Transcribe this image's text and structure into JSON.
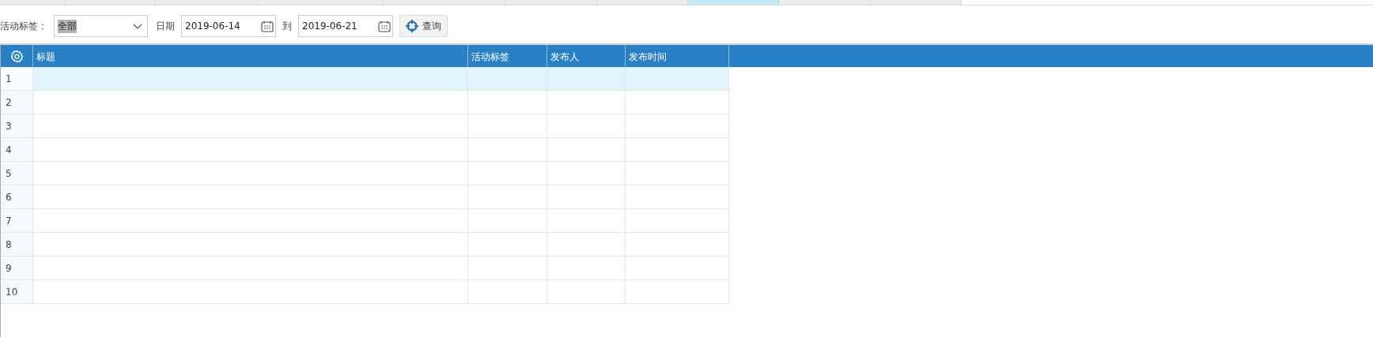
{
  "tabs": [
    {
      "selected": false
    },
    {
      "selected": false
    },
    {
      "selected": false
    },
    {
      "selected": false
    },
    {
      "selected": false
    },
    {
      "selected": false
    },
    {
      "selected": false
    },
    {
      "selected": true
    },
    {
      "selected": false
    },
    {
      "selected": false
    }
  ],
  "filters": {
    "tag_label": "活动标签：",
    "tag_value": "全部",
    "date_label": "日期",
    "date_from": "2019-06-14",
    "to_label": "到",
    "date_to": "2019-06-21",
    "query_button": "查询"
  },
  "table": {
    "columns": [
      "标题",
      "活动标签",
      "发布人",
      "发布时间"
    ],
    "rows": [
      {
        "number": "1",
        "selected": true
      },
      {
        "number": "2",
        "selected": false
      },
      {
        "number": "3",
        "selected": false
      },
      {
        "number": "4",
        "selected": false
      },
      {
        "number": "5",
        "selected": false
      },
      {
        "number": "6",
        "selected": false
      },
      {
        "number": "7",
        "selected": false
      },
      {
        "number": "8",
        "selected": false
      },
      {
        "number": "9",
        "selected": false
      },
      {
        "number": "10",
        "selected": false
      }
    ]
  }
}
